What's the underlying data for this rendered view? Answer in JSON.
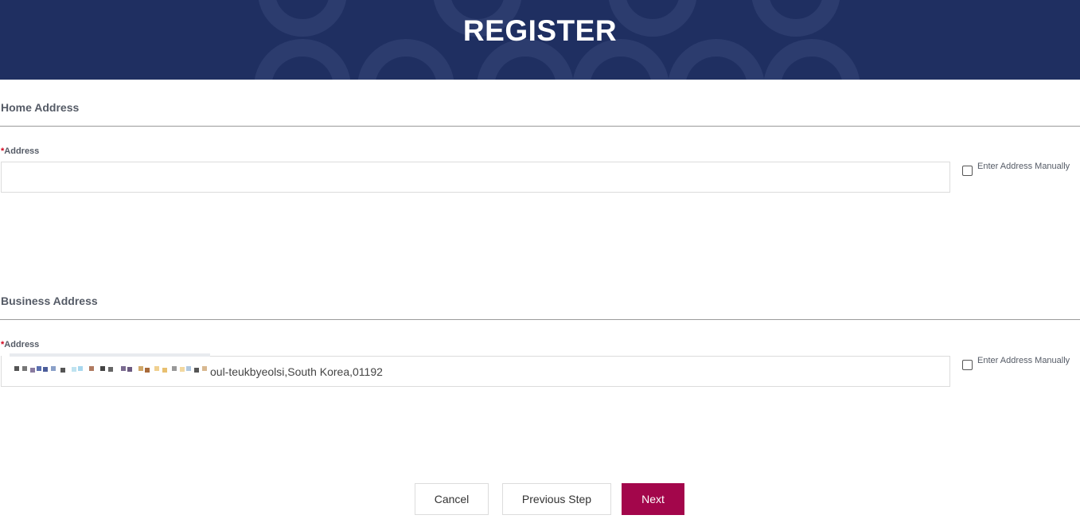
{
  "header": {
    "title": "REGISTER",
    "background_color": "#1f2f61"
  },
  "home_address": {
    "section_title": "Home Address",
    "address_label": "Address",
    "required_marker": "*",
    "address_value": "",
    "manual_checkbox_label": "Enter Address Manually",
    "manual_checked": false
  },
  "business_address": {
    "section_title": "Business Address",
    "address_label": "Address",
    "required_marker": "*",
    "address_value_visible": "oul-teukbyeolsi,South Korea,01192",
    "manual_checkbox_label": "Enter Address Manually",
    "manual_checked": false
  },
  "actions": {
    "cancel_label": "Cancel",
    "previous_label": "Previous Step",
    "next_label": "Next",
    "primary_color": "#a3064b"
  }
}
